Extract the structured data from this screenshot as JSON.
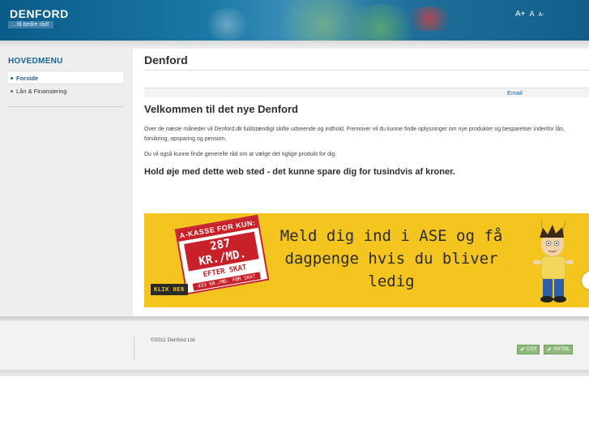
{
  "header": {
    "logo": "DENFORD",
    "tagline": "...få bedre råd!",
    "font_size_controls": [
      "A+",
      "A",
      "A-"
    ],
    "bg_color": "#1a77a6"
  },
  "sidebar": {
    "title": "HOVEDMENU",
    "items": [
      {
        "label": "Forside",
        "active": true
      },
      {
        "label": "Lån & Finansiering",
        "active": false
      }
    ]
  },
  "main": {
    "page_title": "Denford",
    "email_link": "Email",
    "welcome_heading": "Velkommen til det nye Denford",
    "paragraph1": "Over de næste måneder vil Denford.dk fuldstændigt skifte udseende og indhold. Fremover vil du kunne finde oplysninger om nye produkter og besparelser indenfor lån, forsikring, opsparing og pension.",
    "paragraph2": "Du vil også kunne finde generelle råd om at vælge det rigtige produkt for dig.",
    "bold_line": "Hold øje med dette web sted - det kunne spare dig for tusindvis af kroner."
  },
  "banner": {
    "tag_head": "A-KASSE FOR KUN:",
    "tag_price": "287 KR./MD.",
    "tag_after": "EFTER SKAT",
    "tag_before": "433 KR./MD. FØR SKAT",
    "cta": "KLIK HER",
    "line1": "Meld dig ind i ASE og få",
    "line2": "dagpenge hvis du bliver ledig",
    "bg_color": "#f4c51e",
    "accent_color": "#c8212a"
  },
  "footer": {
    "copyright": "©2011 Denford Ltd",
    "badges": [
      "CSS",
      "XHTML"
    ]
  }
}
